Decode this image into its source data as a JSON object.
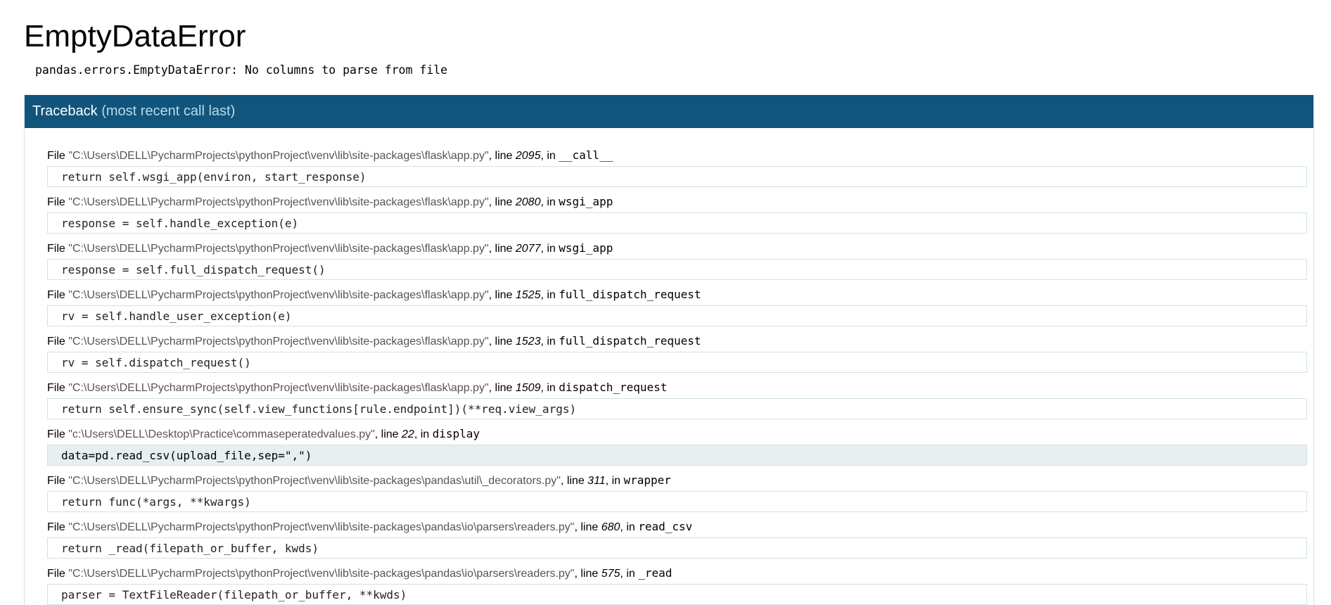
{
  "page": {
    "title": "EmptyDataError",
    "error_message": "pandas.errors.EmptyDataError: No columns to parse from file"
  },
  "traceback": {
    "header_main": "Traceback",
    "header_sub": "(most recent call last)",
    "frames": [
      {
        "file_prefix": "File ",
        "path": "\"C:\\Users\\DELL\\PycharmProjects\\pythonProject\\venv\\lib\\site-packages\\flask\\app.py\"",
        "line_label": ", line ",
        "lineno": "2095",
        "in_label": ", in ",
        "func": "__call__",
        "source": "return self.wsgi_app(environ, start_response)",
        "current": false
      },
      {
        "file_prefix": "File ",
        "path": "\"C:\\Users\\DELL\\PycharmProjects\\pythonProject\\venv\\lib\\site-packages\\flask\\app.py\"",
        "line_label": ", line ",
        "lineno": "2080",
        "in_label": ", in ",
        "func": "wsgi_app",
        "source": "response = self.handle_exception(e)",
        "current": false
      },
      {
        "file_prefix": "File ",
        "path": "\"C:\\Users\\DELL\\PycharmProjects\\pythonProject\\venv\\lib\\site-packages\\flask\\app.py\"",
        "line_label": ", line ",
        "lineno": "2077",
        "in_label": ", in ",
        "func": "wsgi_app",
        "source": "response = self.full_dispatch_request()",
        "current": false
      },
      {
        "file_prefix": "File ",
        "path": "\"C:\\Users\\DELL\\PycharmProjects\\pythonProject\\venv\\lib\\site-packages\\flask\\app.py\"",
        "line_label": ", line ",
        "lineno": "1525",
        "in_label": ", in ",
        "func": "full_dispatch_request",
        "source": "rv = self.handle_user_exception(e)",
        "current": false
      },
      {
        "file_prefix": "File ",
        "path": "\"C:\\Users\\DELL\\PycharmProjects\\pythonProject\\venv\\lib\\site-packages\\flask\\app.py\"",
        "line_label": ", line ",
        "lineno": "1523",
        "in_label": ", in ",
        "func": "full_dispatch_request",
        "source": "rv = self.dispatch_request()",
        "current": false
      },
      {
        "file_prefix": "File ",
        "path": "\"C:\\Users\\DELL\\PycharmProjects\\pythonProject\\venv\\lib\\site-packages\\flask\\app.py\"",
        "line_label": ", line ",
        "lineno": "1509",
        "in_label": ", in ",
        "func": "dispatch_request",
        "source": "return self.ensure_sync(self.view_functions[rule.endpoint])(**req.view_args)",
        "current": false
      },
      {
        "file_prefix": "File ",
        "path": "\"c:\\Users\\DELL\\Desktop\\Practice\\commaseperatedvalues.py\"",
        "line_label": ", line ",
        "lineno": "22",
        "in_label": ", in ",
        "func": "display",
        "source": "data=pd.read_csv(upload_file,sep=\",\")",
        "current": true
      },
      {
        "file_prefix": "File ",
        "path": "\"C:\\Users\\DELL\\PycharmProjects\\pythonProject\\venv\\lib\\site-packages\\pandas\\util\\_decorators.py\"",
        "line_label": ", line ",
        "lineno": "311",
        "in_label": ", in ",
        "func": "wrapper",
        "source": "return func(*args, **kwargs)",
        "current": false
      },
      {
        "file_prefix": "File ",
        "path": "\"C:\\Users\\DELL\\PycharmProjects\\pythonProject\\venv\\lib\\site-packages\\pandas\\io\\parsers\\readers.py\"",
        "line_label": ", line ",
        "lineno": "680",
        "in_label": ", in ",
        "func": "read_csv",
        "source": "return _read(filepath_or_buffer, kwds)",
        "current": false
      },
      {
        "file_prefix": "File ",
        "path": "\"C:\\Users\\DELL\\PycharmProjects\\pythonProject\\venv\\lib\\site-packages\\pandas\\io\\parsers\\readers.py\"",
        "line_label": ", line ",
        "lineno": "575",
        "in_label": ", in ",
        "func": "_read",
        "source": "parser = TextFileReader(filepath_or_buffer, **kwds)",
        "current": false
      }
    ]
  },
  "colors": {
    "header_bg": "#11557c",
    "header_sub": "#b8dbe9",
    "source_border": "#cfe3ea",
    "current_bg": "#e8eff0",
    "path_text": "#555555"
  }
}
